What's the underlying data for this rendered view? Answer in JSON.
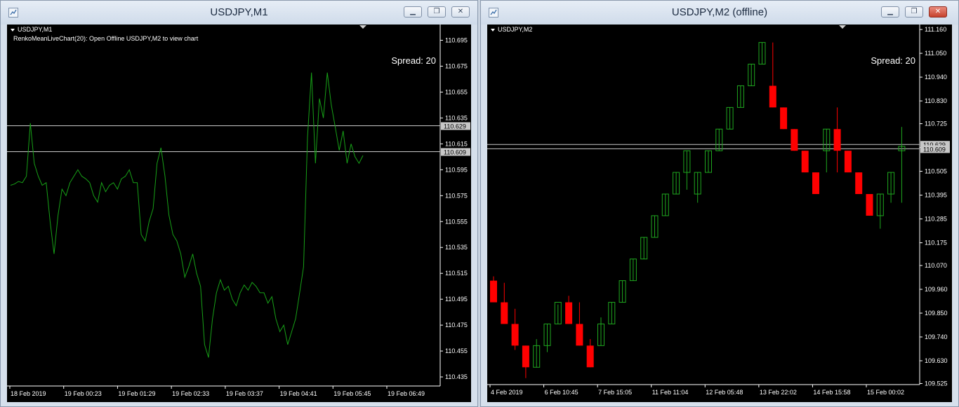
{
  "windows": {
    "left": {
      "title": "USDJPY,M1",
      "symbol_label": "USDJPY,M1",
      "indicator_label": "RenkoMeanLiveChart(20): Open Offline USDJPY,M2 to view chart",
      "spread_label": "Spread: 20",
      "price_ticks": [
        "110.695",
        "110.675",
        "110.655",
        "110.635",
        "110.615",
        "110.595",
        "110.575",
        "110.555",
        "110.535",
        "110.515",
        "110.495",
        "110.475",
        "110.455",
        "110.435"
      ],
      "price_labels": [
        {
          "text": "110.629",
          "price": 110.629
        },
        {
          "text": "110.609",
          "price": 110.609
        }
      ],
      "time_ticks": [
        "18 Feb 2019",
        "19 Feb 00:23",
        "19 Feb 01:29",
        "19 Feb 02:33",
        "19 Feb 03:37",
        "19 Feb 04:41",
        "19 Feb 05:45",
        "19 Feb 06:49"
      ]
    },
    "right": {
      "title": "USDJPY,M2 (offline)",
      "symbol_label": "USDJPY,M2",
      "spread_label": "Spread: 20",
      "price_ticks": [
        "111.160",
        "111.050",
        "110.940",
        "110.830",
        "110.725",
        "110.615",
        "110.505",
        "110.395",
        "110.285",
        "110.175",
        "110.070",
        "109.960",
        "109.850",
        "109.740",
        "109.630",
        "109.525"
      ],
      "price_labels": [
        {
          "text": "110.629",
          "price": 110.629
        },
        {
          "text": "110.609",
          "price": 110.609
        }
      ],
      "time_ticks": [
        "4 Feb 2019",
        "6 Feb 10:45",
        "7 Feb 15:05",
        "11 Feb 11:04",
        "12 Feb 05:48",
        "13 Feb 22:02",
        "14 Feb 15:58",
        "15 Feb 00:02"
      ]
    }
  },
  "colors": {
    "background": "#000000",
    "grid_text": "#ffffff",
    "line": "#17a017",
    "bull_outline": "#1fa81f",
    "bear_fill": "#ff0000",
    "wick_up": "#1fa81f",
    "wick_down": "#ff0000",
    "hline": "#c8c8c8",
    "label_bg": "#c8c8c8",
    "label_text": "#000000"
  },
  "icons": {
    "window_icon": "chart-window-icon",
    "minimize": "minimize-icon",
    "restore": "restore-icon",
    "close": "close-icon"
  },
  "chart_data": [
    {
      "type": "line",
      "title": "USDJPY,M1",
      "ylim": [
        110.428,
        110.705
      ],
      "x": [
        "18 Feb 2019",
        "19 Feb 00:23",
        "19 Feb 01:29",
        "19 Feb 02:33",
        "19 Feb 03:37",
        "19 Feb 04:41",
        "19 Feb 05:45",
        "19 Feb 06:49"
      ],
      "series": [
        {
          "values": [
            110.583,
            110.584,
            110.586,
            110.585,
            110.59,
            110.631,
            110.6,
            110.59,
            110.583,
            110.585,
            110.555,
            110.53,
            110.56,
            110.58,
            110.575,
            110.585,
            110.59,
            110.595,
            110.59,
            110.588,
            110.585,
            110.575,
            110.57,
            110.585,
            110.578,
            110.583,
            110.585,
            110.58,
            110.588,
            110.59,
            110.595,
            110.585,
            110.585,
            110.545,
            110.54,
            110.555,
            110.565,
            110.6,
            110.612,
            110.59,
            110.56,
            110.545,
            110.54,
            110.53,
            110.512,
            110.52,
            110.53,
            110.515,
            110.505,
            110.46,
            110.45,
            110.48,
            110.5,
            110.51,
            110.502,
            110.505,
            110.495,
            110.49,
            110.5,
            110.506,
            110.502,
            110.508,
            110.505,
            110.5,
            110.5,
            110.492,
            110.497,
            110.48,
            110.47,
            110.475,
            110.46,
            110.47,
            110.48,
            110.5,
            110.52,
            110.62,
            110.67,
            110.6,
            110.65,
            110.635,
            110.67,
            110.645,
            110.628,
            110.61,
            110.625,
            110.6,
            110.615,
            110.605,
            110.6,
            110.606
          ]
        }
      ],
      "hlines": [
        110.629,
        110.609
      ]
    },
    {
      "type": "bar",
      "title": "USDJPY,M2 (offline)",
      "ylim": [
        109.52,
        111.17
      ],
      "x": [
        "4 Feb 2019",
        "6 Feb 10:45",
        "7 Feb 15:05",
        "11 Feb 11:04",
        "12 Feb 05:48",
        "13 Feb 22:02",
        "14 Feb 15:58",
        "15 Feb 00:02"
      ],
      "series": [
        {
          "name": "open",
          "values": [
            110.0,
            109.9,
            109.8,
            109.7,
            109.6,
            109.7,
            109.8,
            109.9,
            109.8,
            109.7,
            109.7,
            109.8,
            109.9,
            110.0,
            110.1,
            110.2,
            110.3,
            110.4,
            110.5,
            110.4,
            110.5,
            110.6,
            110.7,
            110.8,
            110.9,
            111.0,
            110.9,
            110.8,
            110.7,
            110.6,
            110.5,
            110.6,
            110.7,
            110.6,
            110.5,
            110.4,
            110.3,
            110.4,
            110.6
          ]
        },
        {
          "name": "close",
          "values": [
            109.9,
            109.8,
            109.7,
            109.6,
            109.7,
            109.8,
            109.9,
            109.8,
            109.7,
            109.6,
            109.8,
            109.9,
            110.0,
            110.1,
            110.2,
            110.3,
            110.4,
            110.5,
            110.6,
            110.5,
            110.6,
            110.7,
            110.8,
            110.9,
            111.0,
            111.1,
            110.8,
            110.7,
            110.6,
            110.5,
            110.4,
            110.7,
            110.6,
            110.5,
            110.4,
            110.3,
            110.4,
            110.5,
            110.62
          ]
        },
        {
          "name": "high",
          "values": [
            110.02,
            109.99,
            109.87,
            109.7,
            109.73,
            109.8,
            109.89,
            109.93,
            109.9,
            109.73,
            109.83,
            109.9,
            110.0,
            110.1,
            110.2,
            110.3,
            110.4,
            110.5,
            110.6,
            110.5,
            110.6,
            110.7,
            110.8,
            110.9,
            111.0,
            111.1,
            111.1,
            110.8,
            110.7,
            110.6,
            110.5,
            110.7,
            110.8,
            110.6,
            110.5,
            110.4,
            110.4,
            110.5,
            110.71
          ]
        },
        {
          "name": "low",
          "values": [
            109.9,
            109.8,
            109.68,
            109.55,
            109.6,
            109.67,
            109.8,
            109.8,
            109.7,
            109.6,
            109.7,
            109.8,
            109.9,
            110.0,
            110.1,
            110.2,
            110.3,
            110.4,
            110.42,
            110.36,
            110.5,
            110.6,
            110.7,
            110.8,
            110.9,
            111.0,
            110.8,
            110.7,
            110.6,
            110.5,
            110.4,
            110.5,
            110.5,
            110.5,
            110.4,
            110.3,
            110.24,
            110.36,
            110.36
          ]
        }
      ],
      "hlines": [
        110.629,
        110.609
      ]
    }
  ]
}
